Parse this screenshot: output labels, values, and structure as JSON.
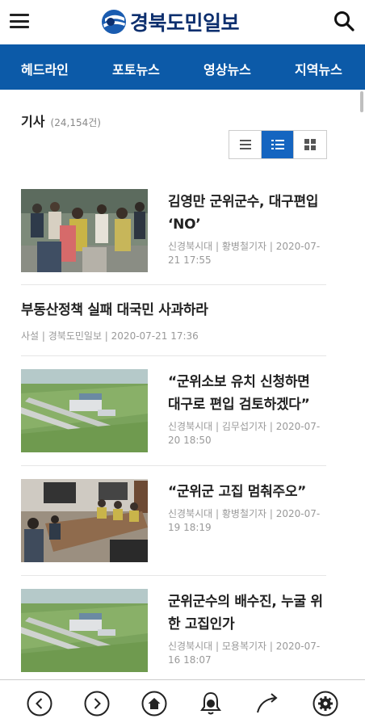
{
  "header": {
    "logo_text": "경북도민일보",
    "logo_icon": "newspaper-logo-mark",
    "brand_color": "#0d2f6e"
  },
  "nav": {
    "background": "#0c5aa8",
    "items": [
      {
        "label": "헤드라인"
      },
      {
        "label": "포토뉴스"
      },
      {
        "label": "영상뉴스"
      },
      {
        "label": "지역뉴스"
      }
    ]
  },
  "list": {
    "label": "기사",
    "count": "(24,154건)",
    "views": [
      {
        "icon": "list-view-icon",
        "active": false
      },
      {
        "icon": "thumbnail-list-view-icon",
        "active": true
      },
      {
        "icon": "grid-view-icon",
        "active": false
      }
    ]
  },
  "articles": [
    {
      "title": "김영만 군위군수, 대구편입 ‘NO’",
      "meta": "신경북시대 | 황병철기자 | 2020-07-21 17:55",
      "thumbnail": "photo-protest"
    },
    {
      "title": "부동산정책 실패 대국민 사과하라",
      "meta": "사설 | 경북도민일보 | 2020-07-21 17:36",
      "thumbnail": null
    },
    {
      "title": "“군위소보 유치 신청하면 대구로 편입 검토하겠다”",
      "meta": "신경북시대 | 김무섭기자 | 2020-07-20 18:50",
      "thumbnail": "airport-rendering"
    },
    {
      "title": "“군위군 고집 멈춰주오”",
      "meta": "신경북시대 | 황병철기자 | 2020-07-19 18:19",
      "thumbnail": "photo-meeting"
    },
    {
      "title": "군위군수의 배수진, 누굴 위한 고집인가",
      "meta": "신경북시대 | 모용복기자 | 2020-07-16 18:07",
      "thumbnail": "airport-rendering"
    }
  ],
  "bottom_bar": {
    "icons": [
      "back-icon",
      "forward-icon",
      "home-icon",
      "notification-bell-icon",
      "share-icon",
      "settings-icon"
    ]
  }
}
